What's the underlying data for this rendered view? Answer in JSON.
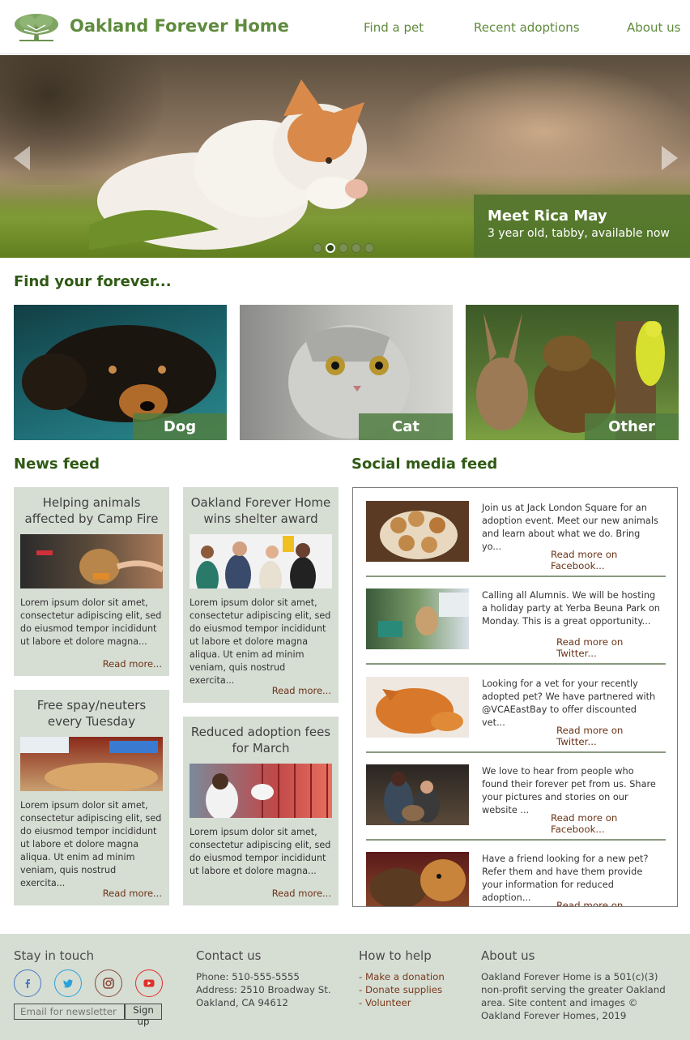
{
  "header": {
    "brand": "Oakland Forever Home",
    "nav": [
      "Find a pet",
      "Recent adoptions",
      "About us"
    ]
  },
  "hero": {
    "caption_title": "Meet Rica May",
    "caption_sub": "3 year old, tabby, available now",
    "slide_count": 5,
    "active_slide": 2
  },
  "find": {
    "heading": "Find your forever...",
    "pets": [
      "Dog",
      "Cat",
      "Other"
    ]
  },
  "news": {
    "heading": "News feed",
    "items": [
      {
        "title": "Helping animals affected by Camp Fire",
        "body": "Lorem ipsum dolor sit amet, consectetur adipiscing elit, sed do eiusmod tempor incididunt ut labore et dolore magna...",
        "link": "Read more..."
      },
      {
        "title": "Oakland Forever Home wins shelter award",
        "body": "Lorem ipsum dolor sit amet, consectetur adipiscing elit, sed do eiusmod tempor incididunt ut labore et dolore magna aliqua. Ut enim ad minim veniam, quis nostrud exercita...",
        "link": "Read more..."
      },
      {
        "title": "Free spay/neuters every Tuesday",
        "body": "Lorem ipsum dolor sit amet, consectetur adipiscing elit, sed do eiusmod tempor incididunt ut labore et dolore magna aliqua. Ut enim ad minim veniam, quis nostrud exercita...",
        "link": "Read more..."
      },
      {
        "title": "Reduced adoption fees for March",
        "body": "Lorem ipsum dolor sit amet, consectetur adipiscing elit, sed do eiusmod tempor incididunt ut labore et dolore magna...",
        "link": "Read more..."
      }
    ]
  },
  "social": {
    "heading": "Social media feed",
    "posts": [
      {
        "text": "Join us at Jack London Square for an adoption event.  Meet our new animals and learn about what we do.  Bring yo...",
        "link": "Read more on Facebook..."
      },
      {
        "text": "Calling all Alumnis.  We will be hosting a holiday party at Yerba Beuna Park on Monday.  This is a great opportunity...",
        "link": "Read more on Twitter..."
      },
      {
        "text": "Looking for a vet for your recently adopted pet?  We have partnered with @VCAEastBay to offer discounted vet...",
        "link": "Read more on Twitter..."
      },
      {
        "text": "We love to hear from people who found their forever pet from us. Share your pictures and stories on our website ...",
        "link": "Read more on Facebook..."
      },
      {
        "text": "Have a friend looking for a new pet? Refer them and have them provide your information for reduced adoption...",
        "link": "Read more on Twitter..."
      }
    ]
  },
  "footer": {
    "stay": {
      "heading": "Stay in touch",
      "placeholder": "Email for newsletter",
      "button": "Sign up",
      "icons": [
        "facebook-icon",
        "twitter-icon",
        "instagram-icon",
        "youtube-icon"
      ]
    },
    "contact": {
      "heading": "Contact us",
      "phone": "Phone: 510-555-5555",
      "address1": "Address: 2510 Broadway St.",
      "address2": "Oakland, CA 94612"
    },
    "help": {
      "heading": "How to help",
      "links": [
        "- Make a donation",
        "- Donate supplies",
        "- Volunteer"
      ]
    },
    "about": {
      "heading": "About us",
      "text": "Oakland Forever Home is a 501(c)(3) non-profit serving the greater Oakland area. Site content and images © Oakland Forever Homes, 2019"
    }
  },
  "colors": {
    "brand_green": "#5f8b3d",
    "heading_green": "#2f5a14",
    "link_brown": "#6b3418",
    "card_bg": "#d6ddd3"
  }
}
